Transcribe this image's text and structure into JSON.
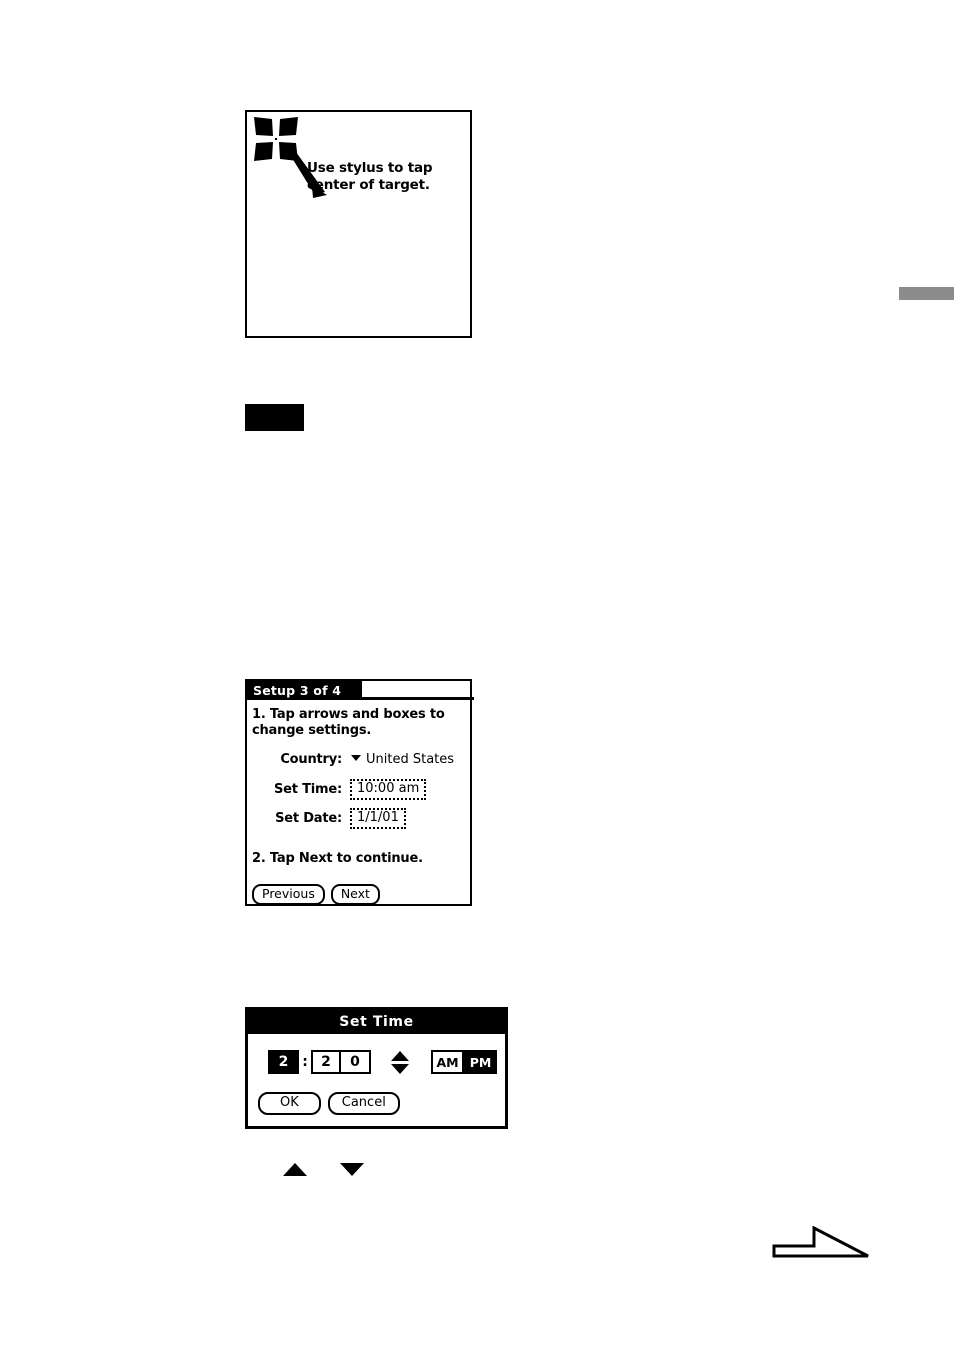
{
  "page": {
    "background_color": "#ffffff",
    "ink_color": "#000000",
    "edge_tab_color": "#8c8c8c"
  },
  "digitizer_screen": {
    "name": "digitizer-calibration-screen",
    "target_icon": "crosshair-target-icon",
    "pointer_icon": "stylus-pointer-icon",
    "caption_line1": "Use stylus to tap",
    "caption_line2": "center of target."
  },
  "black_marker": {
    "name": "black-marker-block",
    "label": ""
  },
  "edge_tab": {
    "name": "page-edge-tab",
    "label": ""
  },
  "setup_screen": {
    "title": "Setup   3 of 4",
    "step1": "1. Tap arrows and boxes to change settings.",
    "step2": "2. Tap Next to continue.",
    "fields": [
      {
        "label": "Country:",
        "value": "United States",
        "control": "dropdown",
        "caret_icon": "chevron-down-icon"
      },
      {
        "label": "Set Time:",
        "value": "10:00 am",
        "control": "dotted-field"
      },
      {
        "label": "Set Date:",
        "value": "1/1/01",
        "control": "dotted-field"
      }
    ],
    "buttons": {
      "previous": "Previous",
      "next": "Next"
    }
  },
  "set_time_dialog": {
    "title": "Set Time",
    "hour": "2",
    "colon": ":",
    "minute_tens": "2",
    "minute_ones": "0",
    "spinner": {
      "up_icon": "triangle-up-icon",
      "down_icon": "triangle-down-icon"
    },
    "meridiem": {
      "am_label": "AM",
      "pm_label": "PM",
      "selected": "AM"
    },
    "buttons": {
      "ok": "OK",
      "cancel": "Cancel"
    }
  },
  "inline_arrows": {
    "up_icon": "triangle-up-icon",
    "down_icon": "triangle-down-icon"
  },
  "page_nav_arrow": {
    "name": "page-forward-arrow-icon",
    "label": ""
  }
}
